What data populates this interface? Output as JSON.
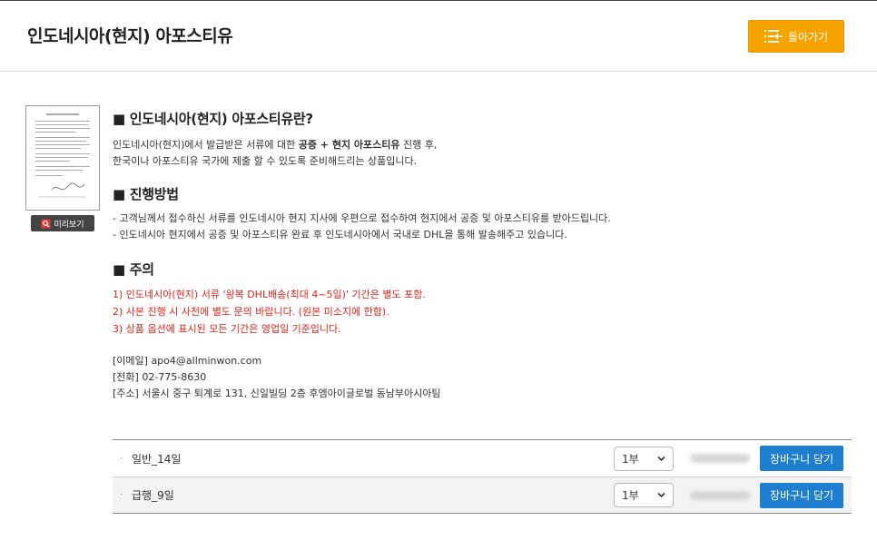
{
  "header": {
    "title": "인도네시아(현지) 아포스티유",
    "back_label": "돌아가기",
    "back_icon": "list-arrow-icon",
    "accent_color": "#f5a300"
  },
  "sidebar": {
    "preview_label": "미리보기",
    "preview_icon": "document-search-icon"
  },
  "sections": {
    "about": {
      "heading": "■ 인도네시아(현지) 아포스티유란?",
      "line1_a": "인도네시아(현지)에서 발급받은 서류에 대한 ",
      "line1_b": "공증 + 현지 아포스티유",
      "line1_c": " 진행 후,",
      "line2": "한국이나 아포스티유 국가에 제출 할 수 있도록 준비해드리는 상품입니다."
    },
    "process": {
      "heading": "■ 진행방법",
      "line1": "- 고객님께서 접수하신 서류를 인도네시아 현지 지사에 우편으로 접수하여 현지에서 공증 및 아포스티유를 받아드립니다.",
      "line2": "- 인도네시아 현지에서 공증 및 아포스티유 완료 후 인도네시아에서 국내로 DHL을 통해 발송해주고 있습니다."
    },
    "caution": {
      "heading": "■ 주의",
      "items": [
        "1) 인도네시아(현지) 서류 '왕복 DHL배송(최대 4~5일)' 기간은 별도 포함.",
        "2) 사본 진행 시 사전에 별도 문의 바랍니다. (원본 미소지에 한함).",
        "3) 상품 옵션에 표시된 모든 기간은 영업일 기준입니다."
      ],
      "warn_color": "#e0251b"
    },
    "contact": {
      "email": "[이메일] apo4@allminwon.com",
      "phone": "[전화] 02-775-8630",
      "address": "[주소] 서울시 중구 퇴계로 131, 신일빌딩 2층 후엠아이글로벌 동남부아시아팀"
    }
  },
  "options": [
    {
      "bullet": "·",
      "label": "일반_14일",
      "qty": "1부",
      "cart_label": "장바구니 담기"
    },
    {
      "bullet": "·",
      "label": "급행_9일",
      "qty": "1부",
      "cart_label": "장바구니 담기"
    }
  ],
  "cart_color": "#1e7fd0"
}
